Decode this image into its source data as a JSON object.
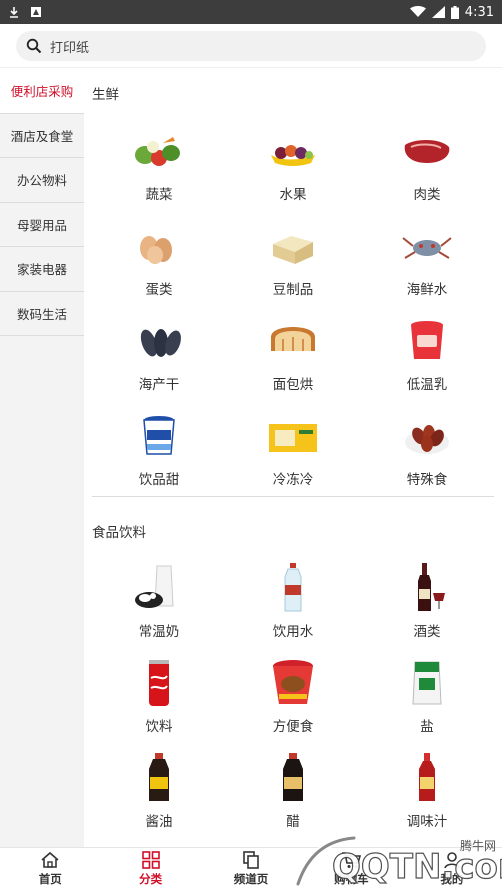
{
  "status_bar": {
    "time": "4:31"
  },
  "search": {
    "placeholder": "打印纸"
  },
  "sidebar": {
    "items": [
      {
        "label": "便利店采购",
        "active": true
      },
      {
        "label": "酒店及食堂",
        "active": false
      },
      {
        "label": "办公物料",
        "active": false
      },
      {
        "label": "母婴用品",
        "active": false
      },
      {
        "label": "家装电器",
        "active": false
      },
      {
        "label": "数码生活",
        "active": false
      }
    ]
  },
  "sections": [
    {
      "title": "生鲜",
      "items": [
        {
          "label": "蔬菜",
          "icon": "vegetables-icon"
        },
        {
          "label": "水果",
          "icon": "fruits-icon"
        },
        {
          "label": "肉类",
          "icon": "meat-icon"
        },
        {
          "label": "蛋类",
          "icon": "eggs-icon"
        },
        {
          "label": "豆制品",
          "icon": "tofu-icon"
        },
        {
          "label": "海鲜水",
          "icon": "seafood-icon"
        },
        {
          "label": "海产干",
          "icon": "dried-seafood-icon"
        },
        {
          "label": "面包烘",
          "icon": "bread-icon"
        },
        {
          "label": "低温乳",
          "icon": "chilled-dairy-icon"
        },
        {
          "label": "饮品甜",
          "icon": "dessert-drink-icon"
        },
        {
          "label": "冷冻冷",
          "icon": "frozen-food-icon"
        },
        {
          "label": "特殊食",
          "icon": "special-food-icon"
        }
      ]
    },
    {
      "title": "食品饮料",
      "items": [
        {
          "label": "常温奶",
          "icon": "milk-icon"
        },
        {
          "label": "饮用水",
          "icon": "water-bottle-icon"
        },
        {
          "label": "酒类",
          "icon": "wine-icon"
        },
        {
          "label": "饮料",
          "icon": "soda-can-icon"
        },
        {
          "label": "方便食",
          "icon": "instant-noodle-icon"
        },
        {
          "label": "盐",
          "icon": "salt-icon"
        },
        {
          "label": "酱油",
          "icon": "soy-sauce-icon"
        },
        {
          "label": "醋",
          "icon": "vinegar-icon"
        },
        {
          "label": "调味汁",
          "icon": "seasoning-sauce-icon"
        }
      ]
    }
  ],
  "tabbar": {
    "tabs": [
      {
        "label": "首页",
        "icon": "home-icon",
        "active": false
      },
      {
        "label": "分类",
        "icon": "category-grid-icon",
        "active": true
      },
      {
        "label": "频道页",
        "icon": "channel-icon",
        "active": false
      },
      {
        "label": "购物车",
        "icon": "cart-icon",
        "active": false
      },
      {
        "label": "我的",
        "icon": "profile-icon",
        "active": false
      }
    ]
  },
  "watermark": {
    "text": "腾牛网",
    "logo": "QQTN.com"
  },
  "colors": {
    "accent": "#d0102a",
    "statusbar": "#3d3d3d",
    "sidebar_bg": "#f3f3f3"
  }
}
